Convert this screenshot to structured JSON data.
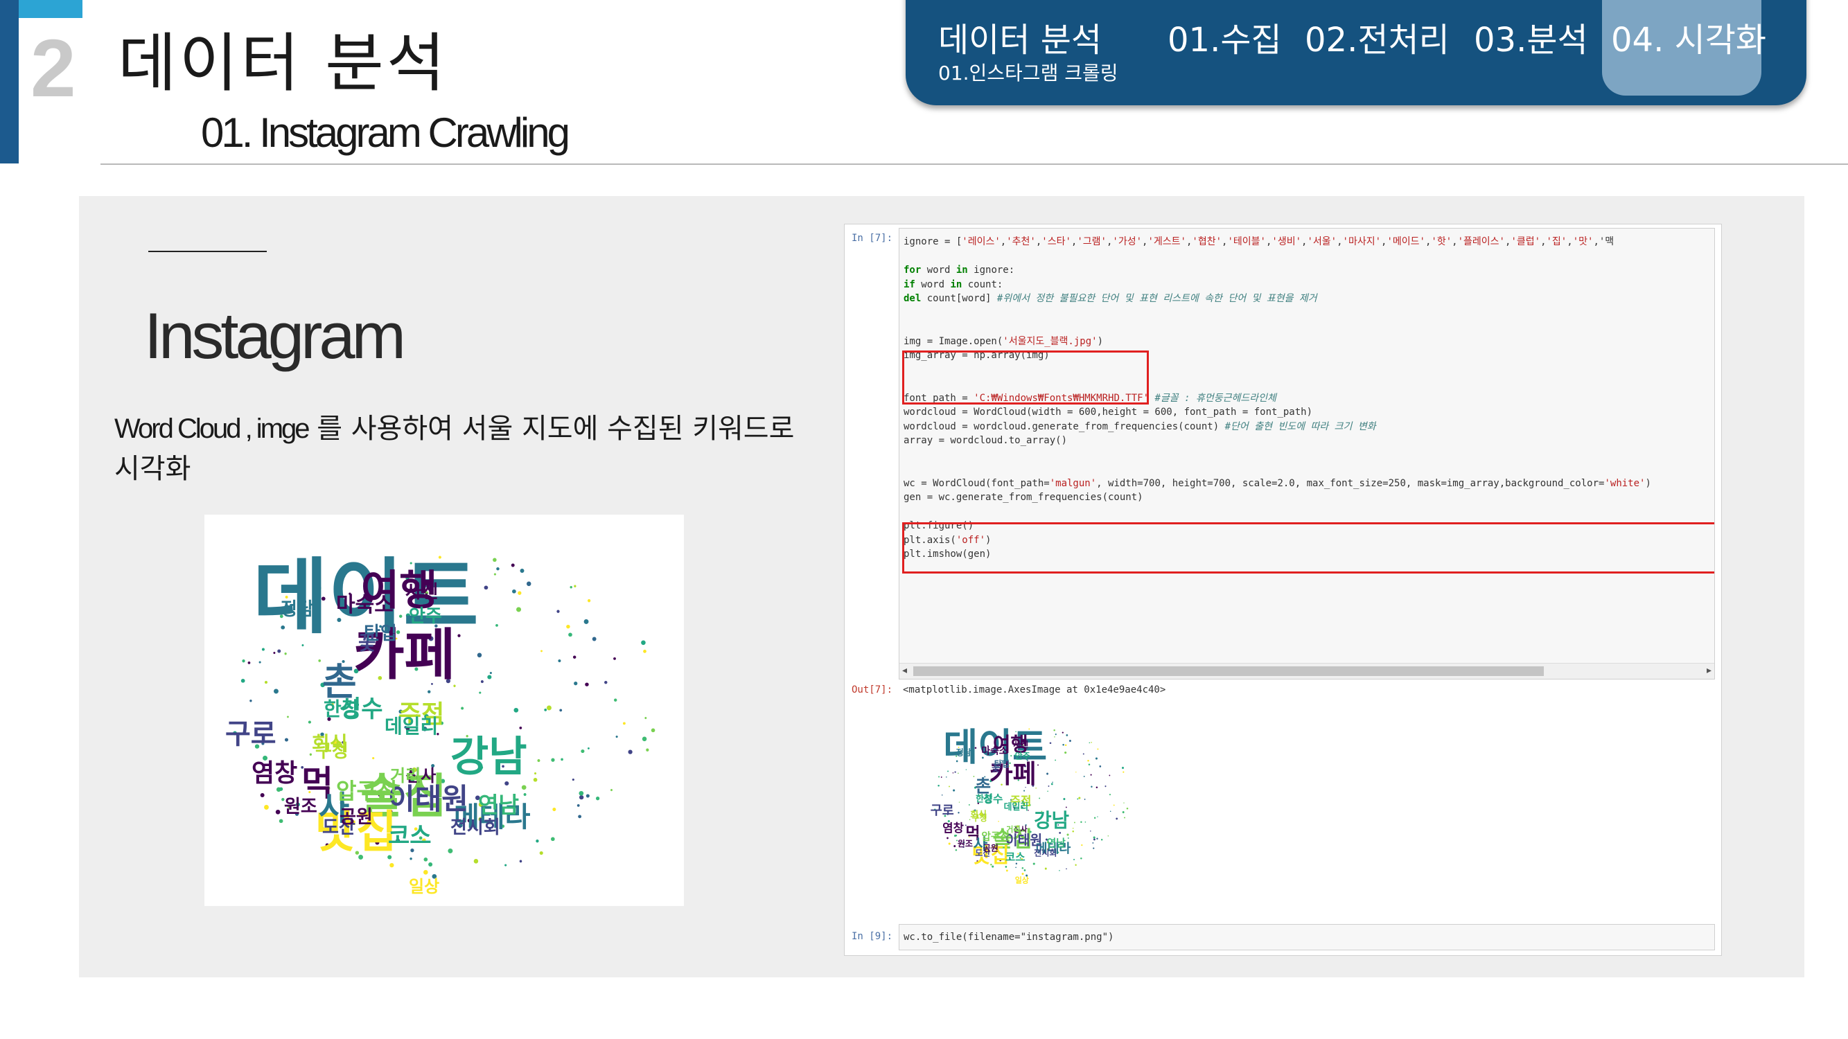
{
  "header": {
    "section_number": "2",
    "title": "데이터  분석",
    "subtitle": "01. Instagram Crawling"
  },
  "nav": {
    "section": "데이터 분석",
    "sub": "01.인스타그램 크롤링",
    "items": [
      "01.수집",
      "02.전처리",
      "03.분석",
      "04. 시각화"
    ],
    "active_index": 3,
    "colors": {
      "banner": "#15527f",
      "highlight": "#8fb4cf"
    }
  },
  "content": {
    "heading": "Instagram",
    "desc_en": "Word Cloud , imge",
    "desc_ko": " 를 사용하여 서울 지도에 수집된 키워드로 시각화"
  },
  "wordcloud": {
    "words": [
      {
        "t": "데이트"
      },
      {
        "t": "카페"
      },
      {
        "t": "술집"
      },
      {
        "t": "여행"
      },
      {
        "t": "맛집"
      },
      {
        "t": "강남"
      },
      {
        "t": "촌"
      },
      {
        "t": "먹"
      },
      {
        "t": "사"
      },
      {
        "t": "구로"
      },
      {
        "t": "메테라"
      },
      {
        "t": "이태원"
      },
      {
        "t": "성수"
      },
      {
        "t": "주점"
      },
      {
        "t": "염창"
      },
      {
        "t": "연남"
      },
      {
        "t": "압구정"
      },
      {
        "t": "한강"
      },
      {
        "t": "도산"
      },
      {
        "t": "공원"
      },
      {
        "t": "코스"
      },
      {
        "t": "신사"
      },
      {
        "t": "마숙소"
      },
      {
        "t": "회식"
      },
      {
        "t": "데일리"
      },
      {
        "t": "전시회"
      },
      {
        "t": "원조"
      },
      {
        "t": "사진"
      },
      {
        "t": "안주"
      },
      {
        "t": "구청"
      },
      {
        "t": "꽃"
      },
      {
        "t": "탄입"
      },
      {
        "t": "일상"
      },
      {
        "t": "거리"
      },
      {
        "t": "정담"
      }
    ]
  },
  "code": {
    "in7_prompt": "In [7]:",
    "out7_prompt": "Out[7]:",
    "in9_prompt": "In [9]:",
    "lines": [
      "ignore = ['레이스','추천','스타','그램','가성','게스트','협찬','테이블','생비','서울','마사지','메이드','핫','플레이스','클럽','집','맛','맥",
      "",
      "for word in ignore:",
      "    if word in count:",
      "        del count[word] #위에서 정한 불필요한 단어 및 표현 리스트에 속한 단어 및 표현을 제거",
      "",
      "",
      "img = Image.open('서울지도_블랙.jpg')",
      "img_array = np.array(img)",
      "",
      "",
      "font_path = 'C:₩Windows₩Fonts₩HMKMRHD.TTF' #글꼴 : 휴먼둥근헤드라인체",
      "wordcloud = WordCloud(width = 600,height = 600, font_path = font_path)",
      "wordcloud = wordcloud.generate_from_frequencies(count) #단어 출현 빈도에 따라 크기 변화",
      "array = wordcloud.to_array()",
      "",
      "",
      "wc = WordCloud(font_path='malgun', width=700, height=700, scale=2.0, max_font_size=250, mask=img_array,background_color='white')",
      "gen = wc.generate_from_frequencies(count)",
      "",
      "plt.figure()",
      "plt.axis('off')",
      "plt.imshow(gen)"
    ],
    "out7_text": "<matplotlib.image.AxesImage at 0x1e4e9ae4c40>",
    "in9_text": "wc.to_file(filename=\"instagram.png\")",
    "highlight_color": "#e02020"
  }
}
